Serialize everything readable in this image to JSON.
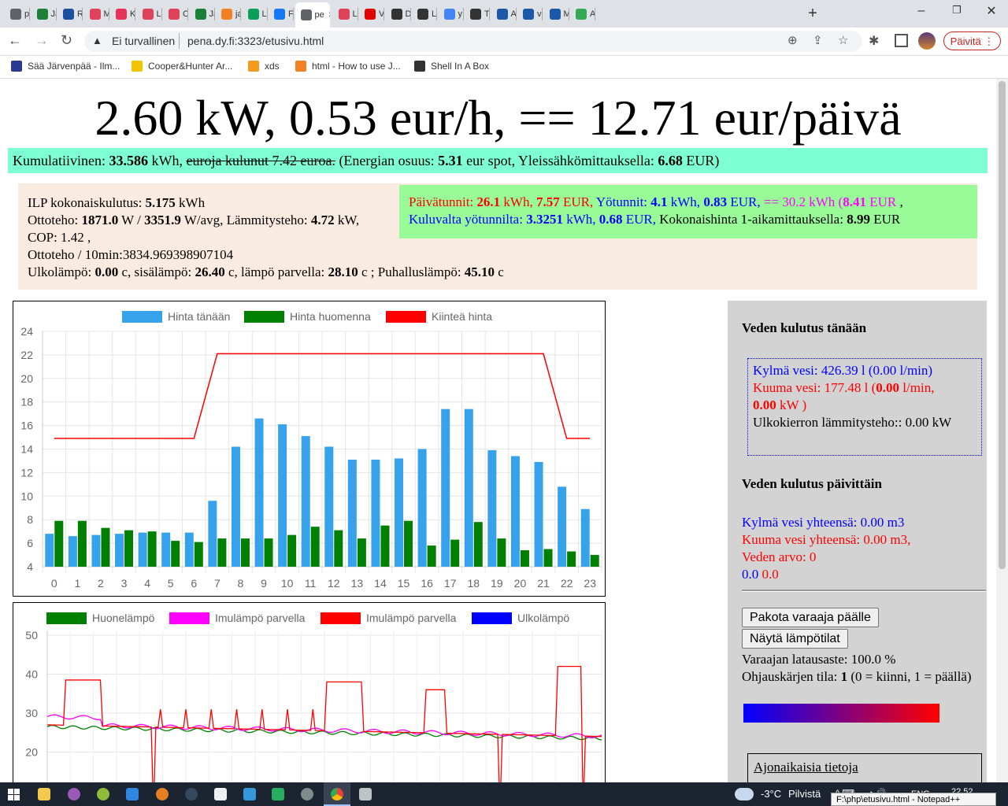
{
  "browser": {
    "tabs": [
      {
        "icon": "chrome-icon",
        "label": "p",
        "color": "#5f6368"
      },
      {
        "icon": "wiki-icon",
        "label": "Ja",
        "color": "#1a7f37"
      },
      {
        "icon": "r-icon",
        "label": "R",
        "color": "#1d4fa0"
      },
      {
        "icon": "pocket-icon",
        "label": "M",
        "color": "#e0425a"
      },
      {
        "icon": "k-icon",
        "label": "K",
        "color": "#e8315a"
      },
      {
        "icon": "pocket-icon",
        "label": "L",
        "color": "#e0425a"
      },
      {
        "icon": "pocket-icon",
        "label": "C",
        "color": "#e0425a"
      },
      {
        "icon": "wiki-icon",
        "label": "Ja",
        "color": "#1a7f37"
      },
      {
        "icon": "stackoverflow-icon",
        "label": "ja",
        "color": "#f48024"
      },
      {
        "icon": "leaf-icon",
        "label": "L",
        "color": "#0a9e5b"
      },
      {
        "icon": "facebook-icon",
        "label": "F",
        "color": "#1877f2"
      },
      {
        "icon": "page-icon",
        "label": "pe",
        "color": "#5f6368"
      },
      {
        "icon": "pocket-icon",
        "label": "L",
        "color": "#e0425a"
      },
      {
        "icon": "mtv-icon",
        "label": "V",
        "color": "#e10600"
      },
      {
        "icon": "wikipedia-icon",
        "label": "D",
        "color": "#333333"
      },
      {
        "icon": "wikipedia-icon",
        "label": "L",
        "color": "#333333"
      },
      {
        "icon": "google-icon",
        "label": "y",
        "color": "#4285f4"
      },
      {
        "icon": "wikipedia-icon",
        "label": "T",
        "color": "#333333"
      },
      {
        "icon": "owl-icon",
        "label": "A",
        "color": "#1c58a8"
      },
      {
        "icon": "owl-icon",
        "label": "v",
        "color": "#1c58a8"
      },
      {
        "icon": "owl-icon",
        "label": "M",
        "color": "#1c58a8"
      },
      {
        "icon": "maps-icon",
        "label": "A",
        "color": "#34a853"
      }
    ],
    "active_tab_index": 11,
    "security_label": "Ei turvallinen",
    "url": "pena.dy.fi:3323/etusivu.html",
    "update_button": "Päivitä",
    "bookmarks": [
      {
        "label": "Sää Järvenpää - Ilm...",
        "color": "#2b3990"
      },
      {
        "label": "Cooper&Hunter Ar...",
        "color": "#f5c400"
      },
      {
        "label": "xds",
        "color": "#f59a1c"
      },
      {
        "label": "html - How to use J...",
        "color": "#f48024"
      },
      {
        "label": "Shell In A Box",
        "color": "#333333"
      }
    ]
  },
  "headline": "2.60 kW, 0.53 eur/h, == 12.71 eur/päivä",
  "kumulatiivinen": {
    "label": "Kumulatiivinen:",
    "kwh": "33.586",
    "kwh_unit": "kWh,",
    "struck": "euroja kulunut 7.42 euroa.",
    "energy_label": "(Energian osuus:",
    "energy_value": "5.31",
    "spot_label": "eur spot, Yleissähkömittauksella:",
    "yleis_value": "6.68",
    "yleis_unit": "EUR)"
  },
  "ilp": {
    "kok_label": "ILP kokonaiskulutus:",
    "kok_value": "5.175",
    "kok_unit": "kWh",
    "otto_label": "Ottoteho:",
    "otto_value": "1871.0",
    "otto_mid": "W /",
    "otto_avg": "3351.9",
    "otto_avg_unit": "W/avg, Lämmitysteho:",
    "lammitys_value": "4.72",
    "cop_text": "kW, COP: 1.42 ,",
    "otto10": "Ottoteho / 10min:3834.969398907104",
    "ulko_label": "Ulkolämpö:",
    "ulko_value": "0.00",
    "sisa_label": "c, sisälämpö:",
    "sisa_value": "26.40",
    "parvi_label": "c, lämpö parvella:",
    "parvi_value": "28.10",
    "puhallus_label": "c ; Puhalluslämpö:",
    "puhallus_value": "45.10",
    "puhallus_unit": "c"
  },
  "tunnit": {
    "paiva_label": "Päivätunnit:",
    "paiva_kwh": "26.1",
    "paiva_kwh_unit": "kWh,",
    "paiva_eur": "7.57",
    "paiva_eur_unit": "EUR,",
    "yo_label": "Yötunnit:",
    "yo_kwh": "4.1",
    "yo_kwh_unit": "kWh,",
    "yo_eur": "0.83",
    "yo_eur_unit": "EUR,",
    "tot_prefix": "== 30.2",
    "tot_kwh_unit": "kWh (",
    "tot_eur": "8.41",
    "tot_eur_unit": "EUR",
    "tot_suffix": ",",
    "kuluvalta_label": "Kuluvalta yötunnilta:",
    "kuluvalta_kwh": "3.3251",
    "kuluvalta_kwh_unit": "kWh,",
    "kuluvalta_eur": "0.68",
    "kuluvalta_eur_unit": "EUR,",
    "kokonais_label": "Kokonaishinta 1-aikamittauksella:",
    "kokonais_value": "8.99",
    "kokonais_unit": "EUR"
  },
  "chart_data": [
    {
      "type": "bar",
      "title": "",
      "categories": [
        "0",
        "1",
        "2",
        "3",
        "4",
        "5",
        "6",
        "7",
        "8",
        "9",
        "10",
        "11",
        "12",
        "13",
        "14",
        "15",
        "16",
        "17",
        "18",
        "19",
        "20",
        "21",
        "22",
        "23"
      ],
      "series": [
        {
          "name": "Hinta tänään",
          "type": "bar",
          "color": "#36a2eb",
          "values": [
            6.8,
            6.6,
            6.7,
            6.8,
            6.9,
            6.9,
            6.9,
            9.6,
            14.2,
            16.6,
            16.1,
            15.1,
            14.2,
            13.1,
            13.1,
            13.2,
            14.0,
            17.4,
            17.4,
            13.9,
            13.4,
            12.9,
            10.8,
            8.9
          ]
        },
        {
          "name": "Hinta huomenna",
          "type": "bar",
          "color": "#008000",
          "values": [
            7.9,
            7.9,
            7.3,
            7.1,
            7.0,
            6.2,
            6.1,
            6.4,
            6.4,
            6.4,
            6.7,
            7.4,
            7.1,
            6.4,
            7.5,
            7.9,
            5.8,
            6.3,
            7.8,
            6.4,
            5.4,
            5.5,
            5.3,
            5.0
          ]
        },
        {
          "name": "Kiinteä hinta",
          "type": "line",
          "color": "#ff0000",
          "values": [
            14.9,
            14.9,
            14.9,
            14.9,
            14.9,
            14.9,
            14.9,
            22.1,
            22.1,
            22.1,
            22.1,
            22.1,
            22.1,
            22.1,
            22.1,
            22.1,
            22.1,
            22.1,
            22.1,
            22.1,
            22.1,
            22.1,
            14.9,
            14.9
          ]
        }
      ],
      "ylim": [
        4,
        24
      ],
      "yticks": [
        4,
        6,
        8,
        10,
        12,
        14,
        16,
        18,
        20,
        22,
        24
      ],
      "grid": true,
      "legend": "top"
    },
    {
      "type": "line",
      "title": "",
      "series": [
        {
          "name": "Huonelämpö",
          "color": "#008000"
        },
        {
          "name": "Imulämpö parvella",
          "color": "#ff00ff"
        },
        {
          "name": "Imulämpö parvella",
          "color": "#ff0000"
        },
        {
          "name": "Ulkolämpö",
          "color": "#0000ff"
        }
      ],
      "yticks": [
        20,
        30,
        40,
        50
      ],
      "ylim": [
        15,
        50
      ],
      "grid": true,
      "legend": "top"
    }
  ],
  "side": {
    "title_today": "Veden kulutus tänään",
    "cold_text": "Kylmä vesi: 426.39 l (0.00 l/min)",
    "hot_prefix": "Kuuma vesi: 177.48 l (",
    "hot_lmin": "0.00",
    "hot_mid": "l/min,",
    "hot_kw": "0.00",
    "hot_suffix": "kW )",
    "ulkokierto": "Ulkokierron lämmitysteho:: 0.00 kW",
    "title_daily": "Veden kulutus päivittäin",
    "cold_total": "Kylmä vesi yhteensä: 0.00 m3",
    "hot_total": "Kuuma vesi yhteensä: 0.00 m3,",
    "water_value": "Veden arvo: 0",
    "blue_val": "0.0",
    "red_val": "0.0",
    "btn_force": "Pakota varaaja päälle",
    "btn_temps": "Näytä lämpötilat",
    "charge_text": "Varaajan latausaste: 100.0 %",
    "ohjaus_label": "Ohjauskärjen tila:",
    "ohjaus_value": "1",
    "ohjaus_suffix": "(0 = kiinni, 1 = päällä)",
    "ajonaikaiset": "Ajonaikaisia tietoja"
  },
  "taskbar": {
    "weather_temp": "-3°C",
    "weather_text": "Pilvistä",
    "lang": "ENG",
    "time": "22.52",
    "notepad": "F:\\php\\etusivu.html - Notepad++"
  }
}
